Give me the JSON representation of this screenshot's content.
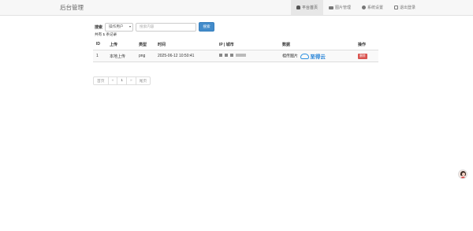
{
  "header": {
    "brand": "后台管理",
    "nav": [
      {
        "label": "平台首页",
        "icon": "user-icon",
        "active": true
      },
      {
        "label": "图片管理",
        "icon": "picture-icon",
        "active": false
      },
      {
        "label": "系统设置",
        "icon": "gear-icon",
        "active": false
      },
      {
        "label": "退出登录",
        "icon": "logout-icon",
        "active": false
      }
    ]
  },
  "search": {
    "label": "搜索",
    "field_select": "操作用户",
    "input_placeholder": "搜索内容",
    "button": "搜索"
  },
  "summary": {
    "prefix": "共有",
    "count": "1",
    "suffix": "条记录"
  },
  "table": {
    "columns": [
      "ID",
      "上传",
      "类型",
      "时间",
      "IP | 城市",
      "数据",
      "操作"
    ],
    "rows": [
      {
        "id": "1",
        "upload": "本地上传",
        "type": "png",
        "time": "2025-06-12 10:50:41",
        "data_label": "相传图片",
        "data_logo_text": "至得云",
        "action": "删除"
      }
    ]
  },
  "pagination": {
    "first": "首页",
    "prev": "«",
    "current": "1",
    "next": "»",
    "last": "尾页"
  },
  "colors": {
    "primary": "#428bca",
    "danger": "#d9534f",
    "logo_blue": "#1f7fd6"
  }
}
